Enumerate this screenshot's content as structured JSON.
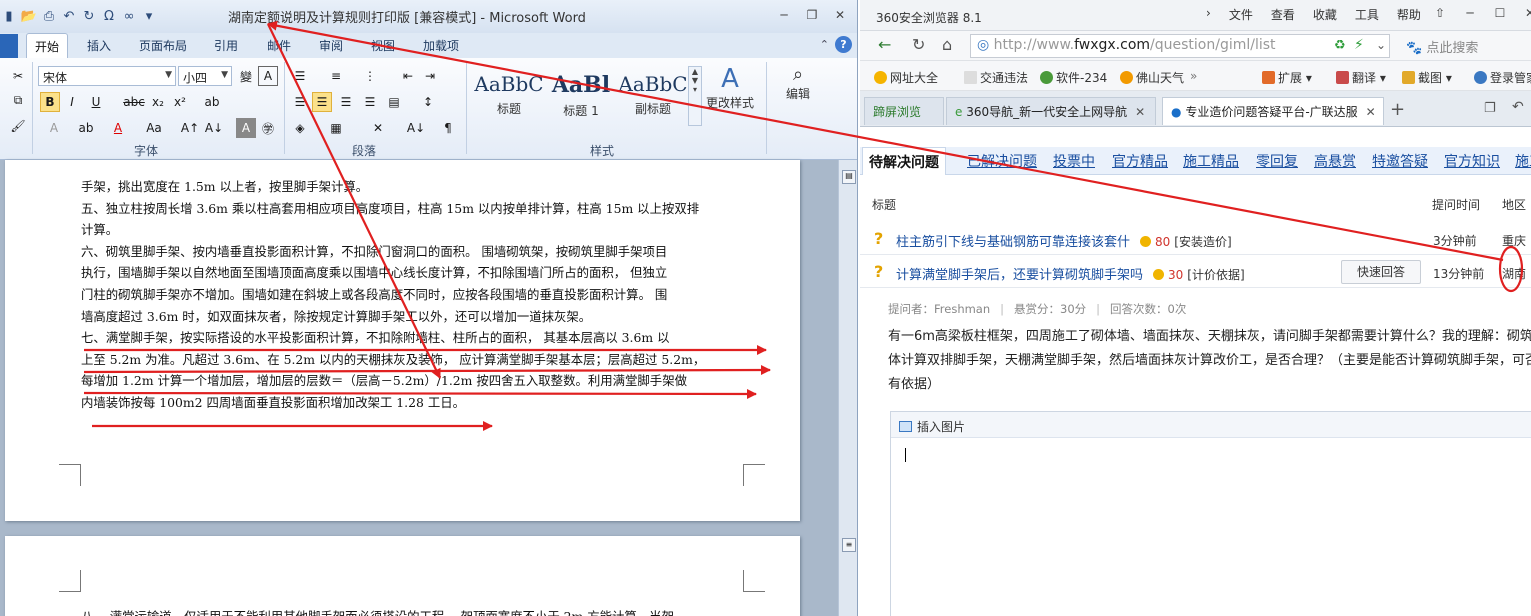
{
  "word": {
    "title": "湖南定额说明及计算规则打印版 [兼容模式] - Microsoft Word",
    "tabs": [
      "开始",
      "插入",
      "页面布局",
      "引用",
      "邮件",
      "审阅",
      "视图",
      "加载项"
    ],
    "font_name": "宋体",
    "font_size": "小四",
    "groups": {
      "font": "字体",
      "paragraph": "段落",
      "styles": "样式"
    },
    "styles": [
      {
        "sample": "AaBbC",
        "name": "标题"
      },
      {
        "sample": "AaBl",
        "name": "标题 1"
      },
      {
        "sample": "AaBbC",
        "name": "副标题"
      }
    ],
    "change_styles": "更改样式",
    "edit": "编辑",
    "doc_lines": [
      "手架，挑出宽度在 1.5m 以上者，按里脚手架计算。",
      "五、独立柱按周长增 3.6m 乘以柱高套用相应项目高度项目，柱高 15m 以内按单排计算，柱高 15m 以上按双排",
      "计算。",
      "六、砌筑里脚手架、按内墙垂直投影面积计算，不扣除门窗洞口的面积。 围墙砌筑架，按砌筑里脚手架项目",
      "执行，围墙脚手架以自然地面至围墙顶面高度乘以围墙中心线长度计算，不扣除围墙门所占的面积， 但独立",
      "门柱的砌筑脚手架亦不增加。围墙如建在斜坡上或各段高度不同时，应按各段围墙的垂直投影面积计算。 围",
      "墙高度超过 3.6m 时，如双面抹灰者，除按规定计算脚手架工以外，还可以增加一道抹灰架。",
      "七、满堂脚手架，按实际搭设的水平投影面积计算，不扣除附墙柱、柱所占的面积， 其基本层高以 3.6m 以",
      "上至 5.2m 为准。凡超过 3.6m、在 5.2m 以内的天棚抹灰及装饰， 应计算满堂脚手架基本层；层高超过 5.2m，",
      "每增加 1.2m 计算一个增加层，增加层的层数＝（层高－5.2m）/1.2m 按四舍五入取整数。利用满堂脚手架做",
      "内墙装饰按每 100m2 四周墙面垂直投影面积增加改架工 1.28 工日。"
    ],
    "page2_line": "八、 满堂运输道，仅适用于不能利用其他脚手架而必须搭设的工程， 架顶面宽度不小于 2m 方能计算，当架"
  },
  "browser": {
    "title": "360安全浏览器 8.1",
    "menu": [
      "文件",
      "查看",
      "收藏",
      "工具",
      "帮助"
    ],
    "url_prefix": "http://www.",
    "url_host": "fwxgx.com",
    "url_path": "/question/giml/list",
    "search_placeholder": "点此搜索",
    "favorites": [
      "网址大全",
      "交通违法",
      "软件-234",
      "佛山天气",
      "扩展",
      "翻译",
      "截图",
      "登录管家"
    ],
    "tabs": [
      "蹄屏浏览",
      "360导航_新一代安全上网导航",
      "专业造价问题答疑平台-广联达服"
    ],
    "categories": [
      "待解决问题",
      "已解决问题",
      "投票中",
      "官方精品",
      "施工精品",
      "零回复",
      "高悬赏",
      "特邀答疑",
      "官方知识",
      "施工知识"
    ],
    "list_head": {
      "title": "标题",
      "time": "提问时间",
      "region": "地区"
    },
    "questions": [
      {
        "title": "柱主筋引下线与基础钢筋可靠连接该套什",
        "score": "80",
        "tag": "[安装造价]",
        "time": "3分钟前",
        "region": "重庆"
      },
      {
        "title": "计算满堂脚手架后，还要计算砌筑脚手架吗",
        "score": "30",
        "tag": "[计价依据]",
        "time": "13分钟前",
        "region": "湖南"
      }
    ],
    "quick_answer": "快速回答",
    "meta": {
      "asker": "提问者：Freshman",
      "reward": "悬赏分：30分",
      "answers": "回答次数：0次"
    },
    "description": "有一6m高梁板柱框架，四周施工了砌体墙、墙面抹灰、天棚抹灰，请问脚手架都需要计算什么？我的理解：砌筑墙体计算双排脚手架，天棚满堂脚手架，然后墙面抹灰计算改价工，是否合理？（主要是能否计算砌筑脚手架，可否有依据）",
    "insert_image": "插入图片"
  },
  "colors": {
    "annotation": "#e02020",
    "link": "#1a4fa0",
    "score": "#d0342c"
  }
}
